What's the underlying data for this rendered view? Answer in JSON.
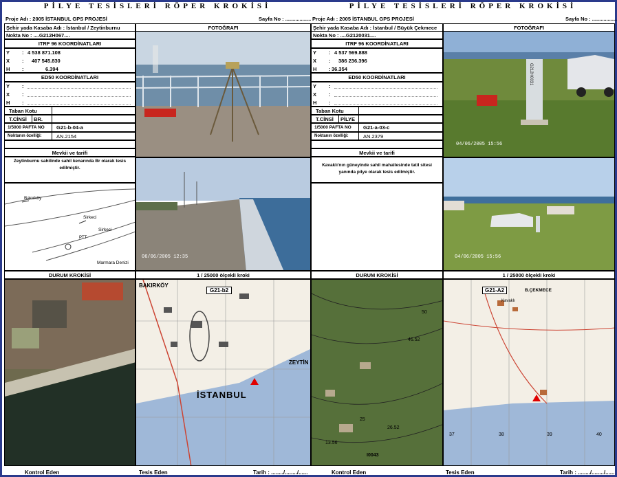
{
  "title": "PİLYE TESİSLERİ RÖPER KROKİSİ",
  "sheets": [
    {
      "project": "Proje Adı : 2005 İSTANBUL GPS  PROJESİ",
      "page": "Sayfa No : ..................",
      "town": "Şehir yada Kasaba Adı : İstanbul / Zeytinburnu",
      "point": "Nokta No : ....G212H067....",
      "photo_header": "FOTOĞRAFI",
      "itrf_header": "ITRF 96 KOORDİNATLARI",
      "y_label": "Y",
      "x_label": "X",
      "h_label": "H",
      "colon": ":",
      "y": "4 538 871.108",
      "x": "407 545.830",
      "h": "6.394",
      "ed50_header": "ED50 KOORDİNATLARI",
      "taban": "Taban Kotu",
      "tcinsi": "T.CİNSİ",
      "tcinsi_val": "BR.",
      "pafta_label": "1/5000 PAFTA NO",
      "pafta_val": "G21-b-04-a",
      "ozellik_label": "Noktanın özelliği:",
      "ozellik_val": "AN.2154",
      "mevki_header": "Mevkii ve tarifi",
      "desc": "Zeytinburnu sahilinde sahil kenarında Br olarak tesis edilmiştir.",
      "sketch_labels": [
        "Bakırköy",
        "Sirkeci",
        "Sirkeci",
        "PTT",
        "Marmara Denizi"
      ],
      "photo2_stamp": "06/06/2005 12:35",
      "durum_header": "DURUM KROKİSİ",
      "olcek_header": "1 / 25000 ölçekli kroki",
      "map_label": "G21-b2",
      "map_texts": [
        "BAKIRKÖY",
        "İSTANBUL",
        "ZEYTİN"
      ],
      "kontrol": "Kontrol Eden",
      "tesis": "Tesis Eden",
      "tarih": "Tarih : ......../......../......"
    },
    {
      "project": "Proje Adı : 2005 İSTANBUL GPS  PROJESİ",
      "page": "Sayfa No : ..................",
      "town": "Şehir yada Kasaba Adı : İstanbul / Büyük Çekmece",
      "point": "Nokta No : ....G2120031....",
      "photo_header": "FOTOĞRAFI",
      "itrf_header": "ITRF 96 KOORDİNATLARI",
      "y_label": "Y",
      "x_label": "X",
      "h_label": "H",
      "colon": ":",
      "y": "4 537 569.888",
      "x": "386 236.396",
      "h": "36.354",
      "ed50_header": "ED50 KOORDİNATLARI",
      "taban": "Taban Kotu",
      "tcinsi": "T.CİNSİ",
      "tcinsi_val": "PİLYE",
      "pafta_label": "1/5000 PAFTA NO",
      "pafta_val": "G21-a-03-c",
      "ozellik_label": "Noktanın özelliği:",
      "ozellik_val": "AN.2379",
      "mevki_header": "Mevkii ve tarifi",
      "desc": "Kavaklı'nın güneyinde sahil mahallesinde tatil sitesi yanında pilye olarak tesis edilmiştir.",
      "photo1_stamp": "04/06/2005 15:56",
      "photo2_stamp": "04/06/2005 15:56",
      "pillar_text": "G212H0031",
      "durum_header": "DURUM KROKİSİ",
      "olcek_header": "1 / 25000 ölçekli kroki",
      "map_label": "G21-A2",
      "map_texts": [
        "Kavaklı",
        "B.ÇEKMECE"
      ],
      "contours": [
        "50",
        "46.52",
        "25",
        "26.52",
        "13.56",
        "I0043"
      ],
      "grid_numbers": [
        "37",
        "38",
        "39",
        "40"
      ],
      "kontrol": "Kontrol Eden",
      "tesis": "Tesis Eden",
      "tarih": "Tarih : ......../......../......"
    }
  ],
  "colors": {
    "frame": "#2a3a8c",
    "marker": "#e00000",
    "sea": "#9fb8d8",
    "map_land": "#f3efe6"
  }
}
